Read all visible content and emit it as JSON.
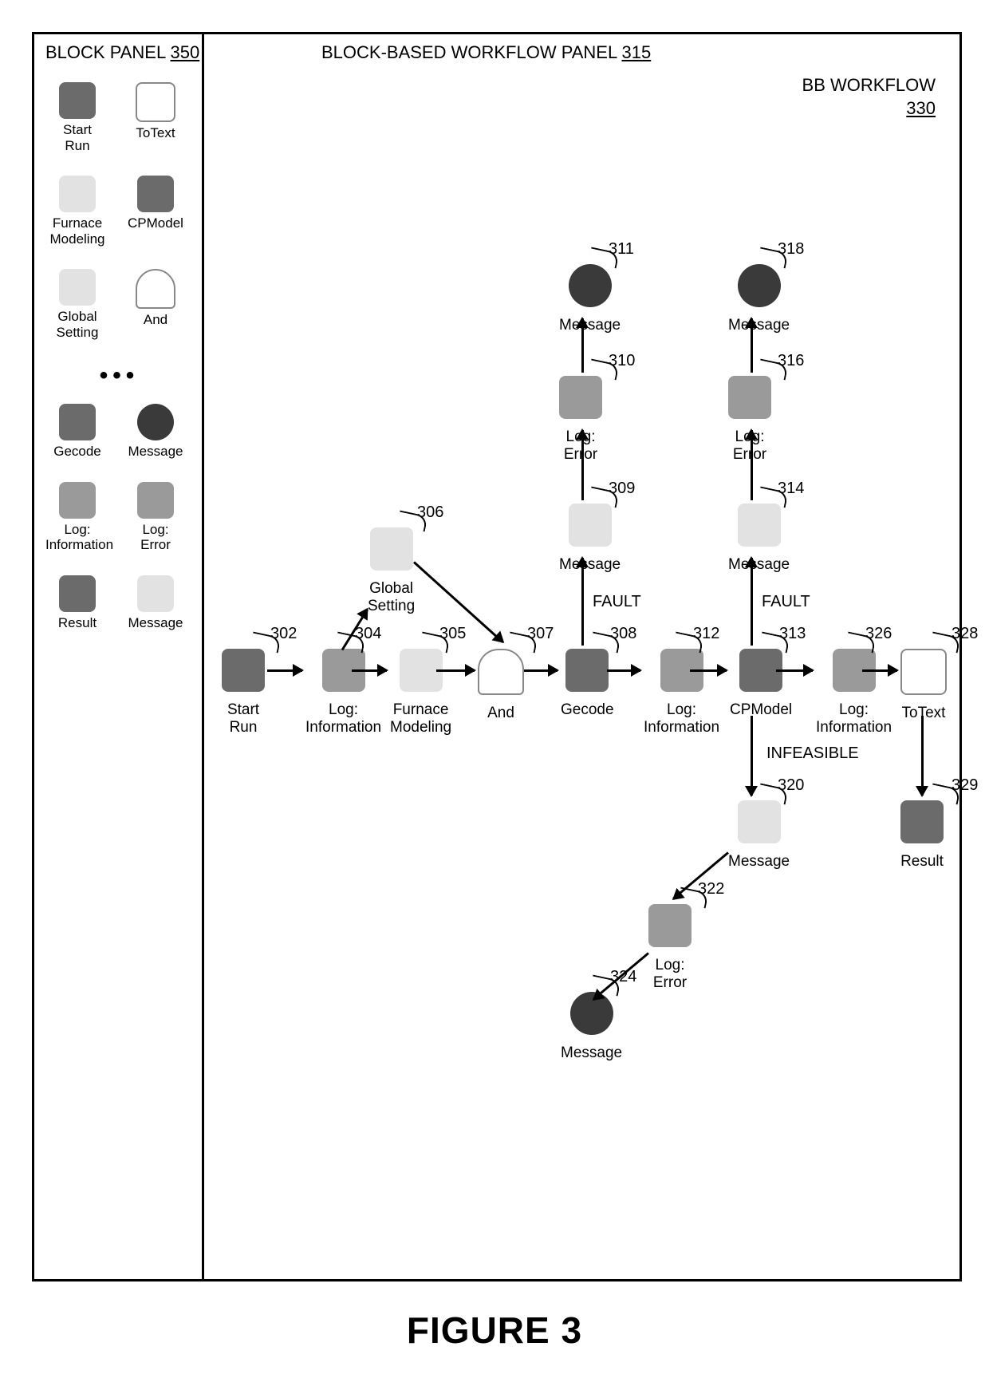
{
  "figure_label": "FIGURE 3",
  "panel_left_title_prefix": "BLOCK PANEL ",
  "panel_left_title_num": "350",
  "panel_right_title_prefix": "BLOCK-BASED WORKFLOW PANEL ",
  "panel_right_title_num": "315",
  "bb_workflow_label": "BB WORKFLOW",
  "bb_workflow_num": "330",
  "palette": {
    "r1a": "Start\nRun",
    "r1b": "ToText",
    "r2a": "Furnace\nModeling",
    "r2b": "CPModel",
    "r3a": "Global\nSetting",
    "r3b": "And",
    "r4a": "Gecode",
    "r4b": "Message",
    "r5a": "Log:\nInformation",
    "r5b": "Log:\nError",
    "r6a": "Result",
    "r6b": "Message"
  },
  "nodes": {
    "n302": {
      "label": "Start\nRun",
      "ref": "302"
    },
    "n304": {
      "label": "Log:\nInformation",
      "ref": "304"
    },
    "n305": {
      "label": "Furnace\nModeling",
      "ref": "305"
    },
    "n306": {
      "label": "Global\nSetting",
      "ref": "306"
    },
    "n307": {
      "label": "And",
      "ref": "307"
    },
    "n308": {
      "label": "Gecode",
      "ref": "308"
    },
    "n309": {
      "label": "Message",
      "ref": "309"
    },
    "n310": {
      "label": "Log:\nError",
      "ref": "310"
    },
    "n311": {
      "label": "Message",
      "ref": "311"
    },
    "n312": {
      "label": "Log:\nInformation",
      "ref": "312"
    },
    "n313": {
      "label": "CPModel",
      "ref": "313"
    },
    "n314": {
      "label": "Message",
      "ref": "314"
    },
    "n316": {
      "label": "Log:\nError",
      "ref": "316"
    },
    "n318": {
      "label": "Message",
      "ref": "318"
    },
    "n320": {
      "label": "Message",
      "ref": "320"
    },
    "n322": {
      "label": "Log:\nError",
      "ref": "322"
    },
    "n324": {
      "label": "Message",
      "ref": "324"
    },
    "n326": {
      "label": "Log:\nInformation",
      "ref": "326"
    },
    "n328": {
      "label": "ToText",
      "ref": "328"
    },
    "n329": {
      "label": "Result",
      "ref": "329"
    }
  },
  "edge_labels": {
    "fault1": "FAULT",
    "fault2": "FAULT",
    "infeasible": "INFEASIBLE"
  }
}
